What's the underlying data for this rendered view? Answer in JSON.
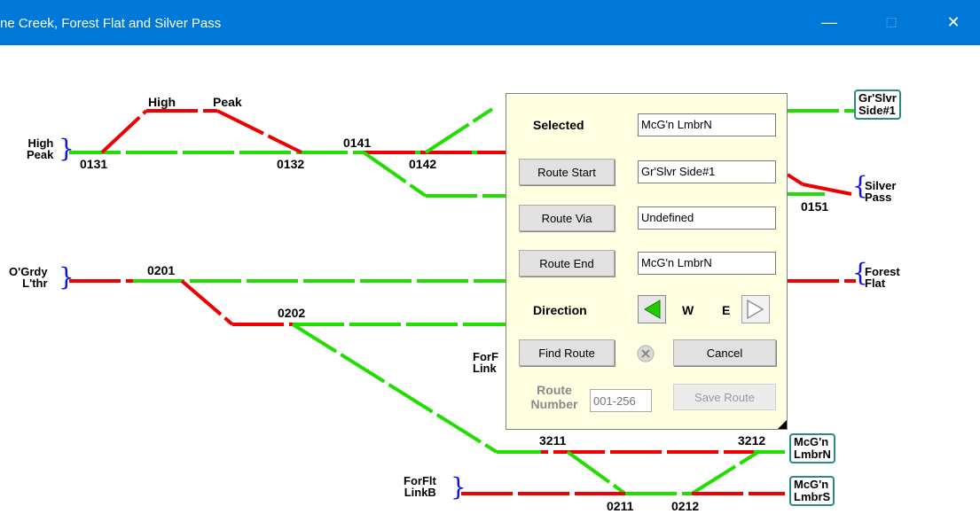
{
  "window": {
    "title": "ne Creek, Forest Flat and Silver Pass",
    "minimize": "—",
    "maximize": "□",
    "close": "✕"
  },
  "diagram": {
    "endpoints": {
      "high_peak_left": [
        "High",
        "Peak"
      ],
      "ogrdy": [
        "O'Grdy",
        "L'thr"
      ],
      "silver_pass": [
        "Silver",
        "Pass"
      ],
      "forest_flat": [
        "Forest",
        "Flat"
      ],
      "forflt_linkb": [
        "ForFlt",
        "LinkB"
      ],
      "forf_link": [
        "ForF",
        "Link"
      ]
    },
    "labels": {
      "high_top": "High",
      "peak_top": "Peak",
      "t0131": "0131",
      "t0132": "0132",
      "t0141": "0141",
      "t0142": "0142",
      "t0151": "0151",
      "t0201": "0201",
      "t0202": "0202",
      "t3211": "3211",
      "t3212": "3212",
      "t0211": "0211",
      "t0212": "0212"
    },
    "boxes": {
      "grslvr_side1": [
        "Gr'Slvr",
        "Side#1"
      ],
      "mcgn_lmbrn": [
        "McG'n",
        "LmbrN"
      ],
      "mcgn_lmbrs": [
        "McG'n",
        "LmbrS"
      ]
    },
    "colors": {
      "set": "#22dd00",
      "unset": "#ee0000",
      "box_border": "#2a8a8a"
    }
  },
  "dialog": {
    "selected_label": "Selected",
    "selected_value": "McG'n LmbrN",
    "route_start_button": "Route Start",
    "route_start_value": "Gr'Slvr Side#1",
    "route_via_button": "Route Via",
    "route_via_value": "Undefined",
    "route_end_button": "Route End",
    "route_end_value": "McG'n LmbrN",
    "direction_label": "Direction",
    "west_label": "W",
    "east_label": "E",
    "find_route_button": "Find Route",
    "cancel_button": "Cancel",
    "route_number_label_1": "Route",
    "route_number_label_2": "Number",
    "route_number_placeholder": "001-256",
    "save_route_button": "Save Route"
  }
}
